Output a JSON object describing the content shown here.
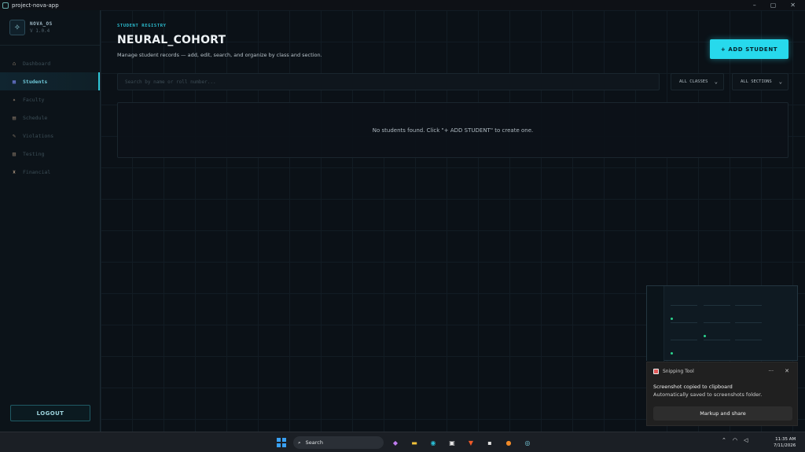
{
  "window": {
    "title": "project-nova-app",
    "controls": [
      "–",
      "▢",
      "✕"
    ]
  },
  "sidebar": {
    "brand": {
      "name": "NOVA_OS",
      "version": "V 1.0.4"
    },
    "items": [
      {
        "label": "Dashboard",
        "icon": "home-icon",
        "glyph": "⌂"
      },
      {
        "label": "Students",
        "icon": "students-icon",
        "glyph": "▦"
      },
      {
        "label": "Faculty",
        "icon": "faculty-icon",
        "glyph": "✦"
      },
      {
        "label": "Schedule",
        "icon": "calendar-icon",
        "glyph": "▤"
      },
      {
        "label": "Violations",
        "icon": "pencil-icon",
        "glyph": "✎"
      },
      {
        "label": "Testing",
        "icon": "clipboard-icon",
        "glyph": "▥"
      },
      {
        "label": "Financial",
        "icon": "money-bag-icon",
        "glyph": "♜"
      }
    ],
    "active_index": 1,
    "logout_label": "LOGOUT"
  },
  "main": {
    "eyebrow": "STUDENT REGISTRY",
    "title": "NEURAL_COHORT",
    "subtitle": "Manage student records — add, edit, search, and organize by class and section.",
    "add_button": "+ ADD STUDENT",
    "search_placeholder": "Search by name or roll number...",
    "filters": {
      "classes": "ALL CLASSES",
      "sections": "ALL SECTIONS"
    },
    "empty_message": "No students found. Click \"+ ADD STUDENT\" to create one."
  },
  "toast": {
    "app_name": "Snipping Tool",
    "actions": [
      "···",
      "✕"
    ],
    "message": "Screenshot copied to clipboard",
    "detail": "Automatically saved to screenshots folder.",
    "button": "Markup and share"
  },
  "taskbar": {
    "search_label": "Search",
    "time": "11:35 AM",
    "date": "7/11/2026",
    "apps": [
      {
        "icon": "copilot-icon",
        "glyph": "◆",
        "color": "#c07cf0"
      },
      {
        "icon": "file-explorer-icon",
        "glyph": "▬",
        "color": "#f2c23a"
      },
      {
        "icon": "edge-icon",
        "glyph": "◉",
        "color": "#2ac0d8"
      },
      {
        "icon": "store-icon",
        "glyph": "▣",
        "color": "#e8e8e8"
      },
      {
        "icon": "brave-icon",
        "glyph": "▼",
        "color": "#f05a28"
      },
      {
        "icon": "terminal-icon",
        "glyph": "▪",
        "color": "#e0e0e0"
      },
      {
        "icon": "firefox-icon",
        "glyph": "●",
        "color": "#f08a28"
      },
      {
        "icon": "nova-app-icon",
        "glyph": "◎",
        "color": "#7ad0e0"
      }
    ]
  }
}
